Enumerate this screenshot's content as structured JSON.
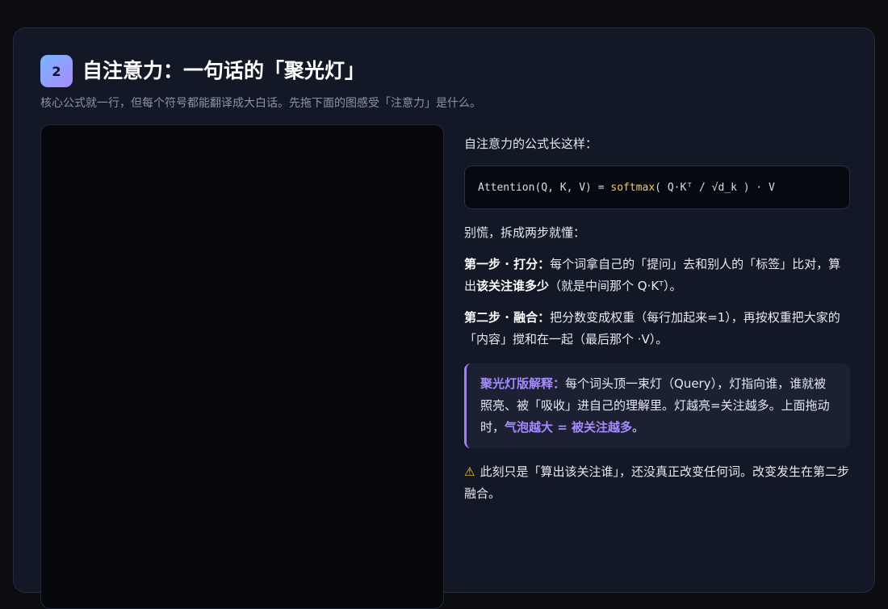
{
  "section": {
    "number": "2",
    "title": "自注意力：一句话的「聚光灯」",
    "subtitle": "核心公式就一行，但每个符号都能翻译成大白话。先拖下面的图感受「注意力」是什么。"
  },
  "content": {
    "intro": "自注意力的公式长这样：",
    "formula": {
      "prefix": "Attention(Q, K, V) = ",
      "fn": "softmax",
      "suffix": "( Q·Kᵀ / √d_k ) · V"
    },
    "lead": "别慌，拆成两步就懂：",
    "step1": {
      "label": "第一步 · 打分：",
      "text_a": "每个词拿自己的「提问」去和别人的「标签」比对，算出",
      "emph": "该关注谁多少",
      "text_b": "（就是中间那个 Q·Kᵀ）。"
    },
    "step2": {
      "label": "第二步 · 融合：",
      "text": "把分数变成权重（每行加起来=1），再按权重把大家的「内容」搅和在一起（最后那个 ·V）。"
    },
    "spotlight": {
      "label": "聚光灯版解释：",
      "text": "每个词头顶一束灯（Query），灯指向谁，谁就被照亮、被「吸收」进自己的理解里。灯越亮=关注越多。上面拖动时，",
      "highlight": "气泡越大 = 被关注越多",
      "end": "。"
    },
    "warning": {
      "icon": "warning-icon",
      "text": "此刻只是「算出该关注谁」，还没真正改变任何词。改变发生在第二步融合。"
    }
  },
  "colors": {
    "accent": "#a58aff",
    "code_fn": "#f5c86b",
    "warning": "#f5c518"
  }
}
